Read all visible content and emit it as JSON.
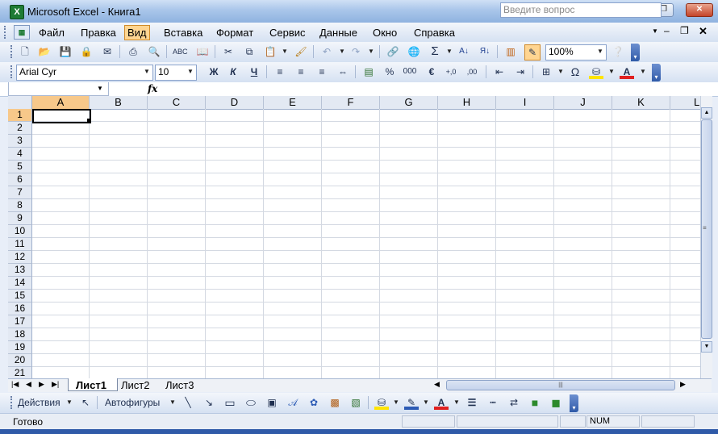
{
  "window": {
    "title": "Microsoft Excel - Книга1",
    "app_icon": "excel-icon",
    "controls": [
      "minimize",
      "restore",
      "close"
    ]
  },
  "menu": {
    "items": [
      "Файл",
      "Правка",
      "Вид",
      "Вставка",
      "Формат",
      "Сервис",
      "Данные",
      "Окно",
      "Справка"
    ],
    "active": "Вид",
    "question_placeholder": "Введите вопрос"
  },
  "standard_toolbar": {
    "zoom": "100%",
    "sum_symbol": "Σ"
  },
  "formatting_toolbar": {
    "font": "Arial Cyr",
    "size": "10",
    "bold": "Ж",
    "italic": "К",
    "underline": "Ч",
    "percent": "%",
    "thousands": "000",
    "euro": "€",
    "increase_decimal": "+,0",
    "decrease_decimal": ",00",
    "omega": "Ω"
  },
  "formula_bar": {
    "name_box": "",
    "fx": "fx",
    "value": ""
  },
  "grid": {
    "columns": [
      "A",
      "B",
      "C",
      "D",
      "E",
      "F",
      "G",
      "H",
      "I",
      "J",
      "K",
      "L"
    ],
    "rows": [
      "1",
      "2",
      "3",
      "4",
      "5",
      "6",
      "7",
      "8",
      "9",
      "10",
      "11",
      "12",
      "13",
      "14",
      "15",
      "16",
      "17",
      "18",
      "19",
      "20",
      "21"
    ],
    "active_cell": "A1"
  },
  "sheets": {
    "tabs": [
      "Лист1",
      "Лист2",
      "Лист3"
    ],
    "active": "Лист1"
  },
  "drawing_toolbar": {
    "actions": "Действия",
    "autoshapes": "Автофигуры"
  },
  "status": {
    "text": "Готово",
    "num": "NUM"
  },
  "colors": {
    "accent_orange": "#f7c88a",
    "toolbar_blue": "#d5e1f2",
    "fill_yellow": "#ffe400",
    "font_red": "#e02020"
  }
}
